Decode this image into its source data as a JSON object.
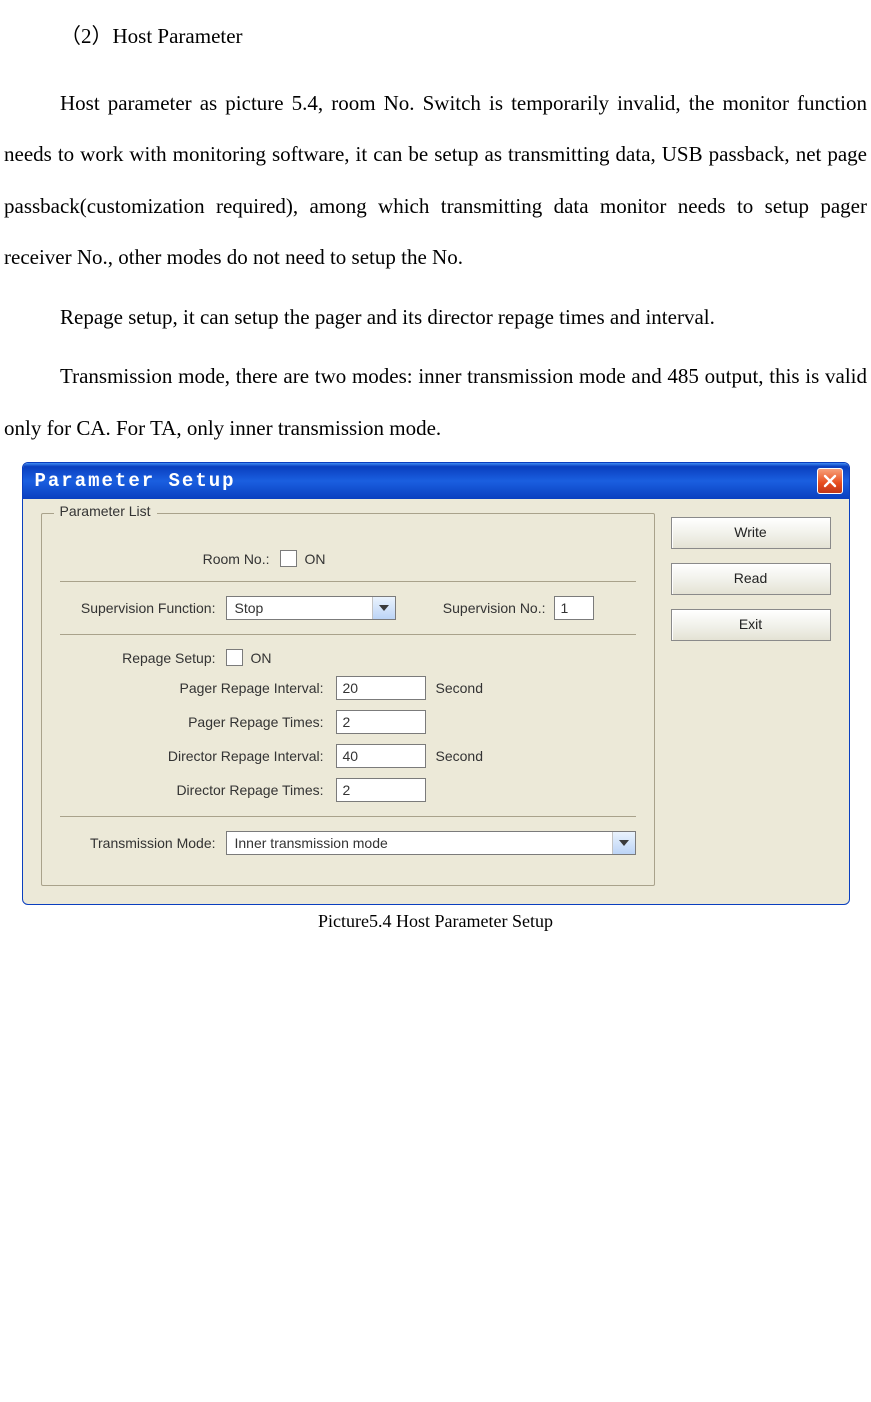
{
  "doc": {
    "heading": "（2）Host Parameter",
    "para1": "Host parameter as picture 5.4, room No. Switch is temporarily invalid, the monitor function needs to work with monitoring software, it can be setup as transmitting data, USB passback, net page passback(customization required), among which transmitting data monitor needs to setup pager receiver No., other modes do not need to setup the No.",
    "para2": "Repage setup, it can setup the pager and its director repage times and interval.",
    "para3": "Transmission mode, there are two modes: inner transmission mode and 485 output, this is valid only for CA. For TA, only inner transmission mode.",
    "caption": "Picture5.4    Host Parameter Setup"
  },
  "dialog": {
    "title": "Parameter Setup",
    "legend": "Parameter List",
    "buttons": {
      "write": "Write",
      "read": "Read",
      "exit": "Exit"
    },
    "room_no": {
      "label": "Room No.:",
      "on": "ON"
    },
    "supervision": {
      "func_label": "Supervision Function:",
      "func_value": "Stop",
      "no_label": "Supervision No.:",
      "no_value": "1"
    },
    "repage": {
      "label": "Repage Setup:",
      "on": "ON",
      "pager_interval_label": "Pager Repage Interval:",
      "pager_interval_value": "20",
      "pager_interval_unit": "Second",
      "pager_times_label": "Pager Repage Times:",
      "pager_times_value": "2",
      "director_interval_label": "Director Repage Interval:",
      "director_interval_value": "40",
      "director_interval_unit": "Second",
      "director_times_label": "Director Repage Times:",
      "director_times_value": "2"
    },
    "transmission": {
      "label": "Transmission Mode:",
      "value": "Inner transmission mode"
    }
  }
}
